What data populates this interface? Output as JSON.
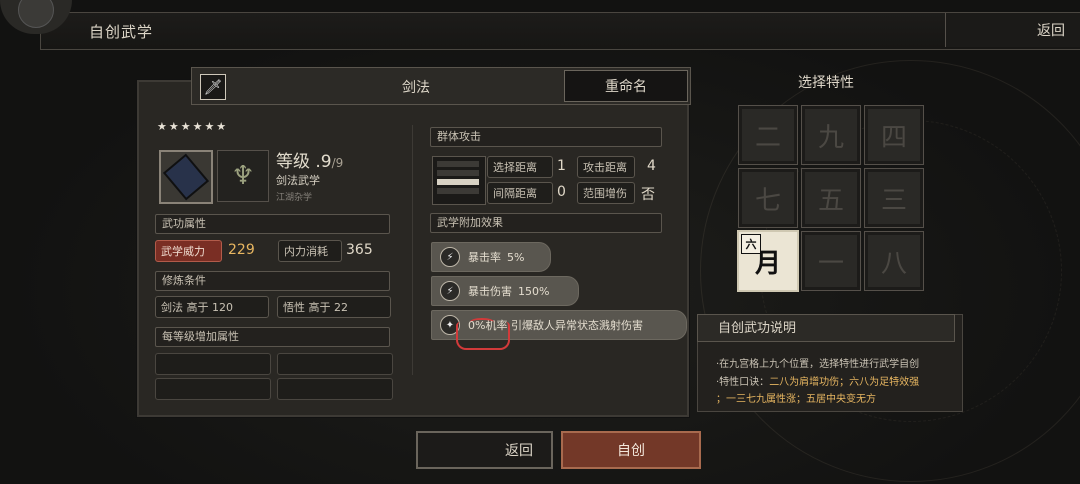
{
  "header": {
    "title": "自创武学",
    "back_label": "返回"
  },
  "skill": {
    "type": "剑法",
    "rename_label": "重命名",
    "stars": "★★★★★★",
    "level_label": "等级",
    "level_value": ".9",
    "level_max": "/9",
    "category": "剑法武学",
    "subcategory": "江湖杂学"
  },
  "attributes": {
    "section_label": "武功属性",
    "power_label": "武学威力",
    "power_value": "229",
    "cost_label": "内力消耗",
    "cost_value": "365"
  },
  "requirements": {
    "section_label": "修炼条件",
    "req1": "剑法 高于 120",
    "req2": "悟性 高于 22"
  },
  "per_level": {
    "section_label": "每等级增加属性"
  },
  "range": {
    "title": "群体攻击",
    "select_label": "选择距离",
    "select_value": "1",
    "attack_label": "攻击距离",
    "attack_value": "4",
    "interval_label": "间隔距离",
    "interval_value": "0",
    "aoe_label": "范围增伤",
    "aoe_value": "否"
  },
  "effects": {
    "section_label": "武学附加效果",
    "items": [
      {
        "name": "暴击率",
        "value": "5%"
      },
      {
        "name": "暴击伤害",
        "value": "150%"
      },
      {
        "name": "0%机率 引爆敌人异常状态溅射伤害",
        "value": ""
      }
    ]
  },
  "traits": {
    "title": "选择特性",
    "cells": [
      "二",
      "九",
      "四",
      "七",
      "五",
      "三",
      "月",
      "一",
      "八"
    ],
    "active_tag": "六"
  },
  "description": {
    "title": "自创武功说明",
    "line1": "·在九宫格上九个位置，选择特性进行武学自创",
    "line2_prefix": "·特性口诀：",
    "line2_gold": "二八为肩增功伤；六八为足特效强",
    "line3_gold": "；一三七九属性涨；五居中央变无方"
  },
  "footer": {
    "back_label": "返回",
    "create_label": "自创"
  },
  "colors": {
    "accent_red": "#7a2e24",
    "gold": "#e7b661",
    "annotation": "#d23a3a"
  }
}
